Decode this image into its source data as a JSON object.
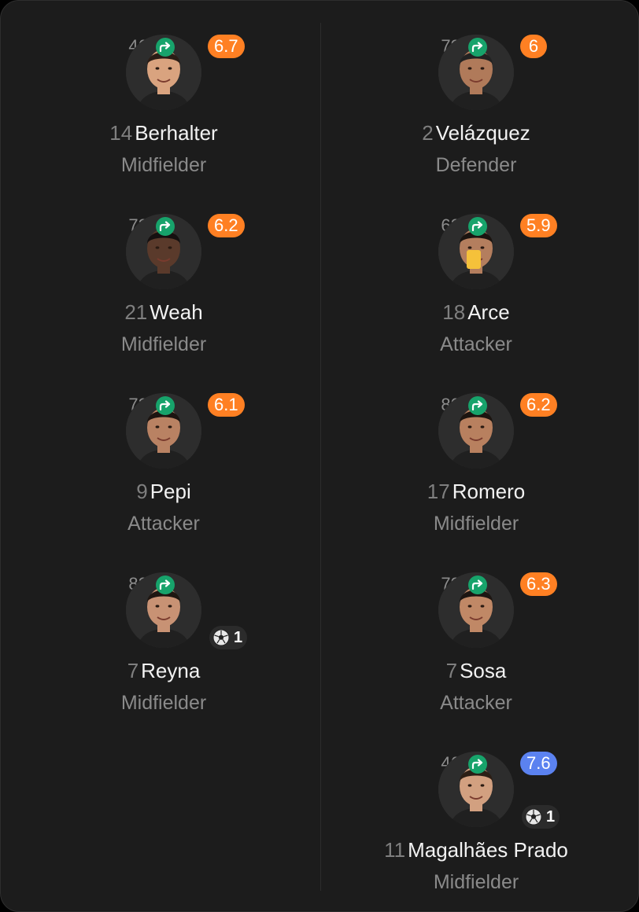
{
  "colors": {
    "rating_orange": "#ff8023",
    "rating_blue": "#5b82f0",
    "sub_green": "#17a36b",
    "yellow_card": "#f5c13a"
  },
  "players": [
    {
      "minute": "46′",
      "rating": "6.7",
      "rating_color": "#ff8023",
      "number": "14",
      "name": "Berhalter",
      "position": "Midfielder",
      "sub_icon": "substitution-arrow-icon"
    },
    {
      "minute": "72′",
      "rating": "6.2",
      "rating_color": "#ff8023",
      "number": "21",
      "name": "Weah",
      "position": "Midfielder",
      "sub_icon": "substitution-arrow-icon"
    },
    {
      "minute": "72′",
      "rating": "6.1",
      "rating_color": "#ff8023",
      "number": "9",
      "name": "Pepi",
      "position": "Attacker",
      "sub_icon": "substitution-arrow-icon"
    },
    {
      "minute": "82′",
      "rating": "",
      "number": "7",
      "name": "Reyna",
      "position": "Midfielder",
      "goals": "1",
      "sub_icon": "substitution-arrow-icon"
    },
    {
      "minute": "79′",
      "rating": "6",
      "rating_color": "#ff8023",
      "number": "2",
      "name": "Velázquez",
      "position": "Defender",
      "sub_icon": "substitution-arrow-icon"
    },
    {
      "minute": "62′",
      "rating": "5.9",
      "rating_color": "#ff8023",
      "number": "18",
      "name": "Arce",
      "position": "Attacker",
      "yellow_card": true,
      "sub_icon": "substitution-arrow-icon"
    },
    {
      "minute": "80′",
      "rating": "6.2",
      "rating_color": "#ff8023",
      "number": "17",
      "name": "Romero",
      "position": "Midfielder",
      "sub_icon": "substitution-arrow-icon"
    },
    {
      "minute": "79′",
      "rating": "6.3",
      "rating_color": "#ff8023",
      "number": "7",
      "name": "Sosa",
      "position": "Attacker",
      "sub_icon": "substitution-arrow-icon"
    },
    {
      "minute": "46′",
      "rating": "7.6",
      "rating_color": "#5b82f0",
      "number": "11",
      "name": "Magalhães Prado",
      "position": "Midfielder",
      "goals": "1",
      "sub_icon": "substitution-arrow-icon"
    }
  ]
}
